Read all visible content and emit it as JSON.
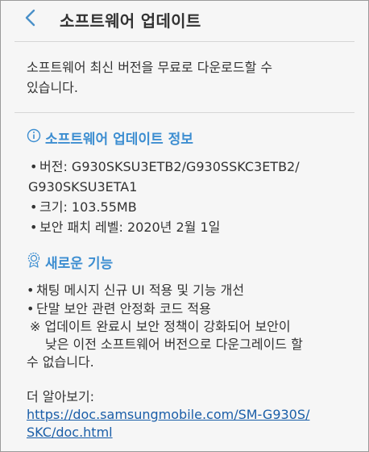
{
  "header": {
    "title": "소프트웨어 업데이트"
  },
  "intro": {
    "line1": "소프트웨어 최신 버전을 무료로 다운로드할 수",
    "line2": "있습니다."
  },
  "info_section": {
    "heading": "소프트웨어 업데이트 정보",
    "version_line1": "버전: G930SKSU3ETB2/G930SSKC3ETB2/",
    "version_line2": "G930SKSU3ETA1",
    "size": "크기: 103.55MB",
    "patch_level": "보안 패치 레벨: 2020년 2월 1일"
  },
  "features_section": {
    "heading": "새로운 기능",
    "item1": "채팅 메시지 신규 UI 적용 및 기능 개선",
    "item2": "단말 보안 관련 안정화 코드 적용",
    "note_line1": "※ 업데이트 완료시 보안 정책이 강화되어 보안이",
    "note_line2": "낮은 이전 소프트웨어 버전으로 다운그레이드 할",
    "note_line3": "수 없습니다."
  },
  "more": {
    "label": "더 알아보기:",
    "link_line1": "https://doc.samsungmobile.com/SM-G930S/",
    "link_line2": "SKC/doc.html"
  },
  "icons": {
    "back": "back-arrow-icon",
    "info": "info-circle-icon",
    "features": "award-badge-icon"
  },
  "colors": {
    "accent": "#3d8ed1",
    "link": "#1a5ea8",
    "text": "#333333",
    "background": "#f6f6f6"
  }
}
